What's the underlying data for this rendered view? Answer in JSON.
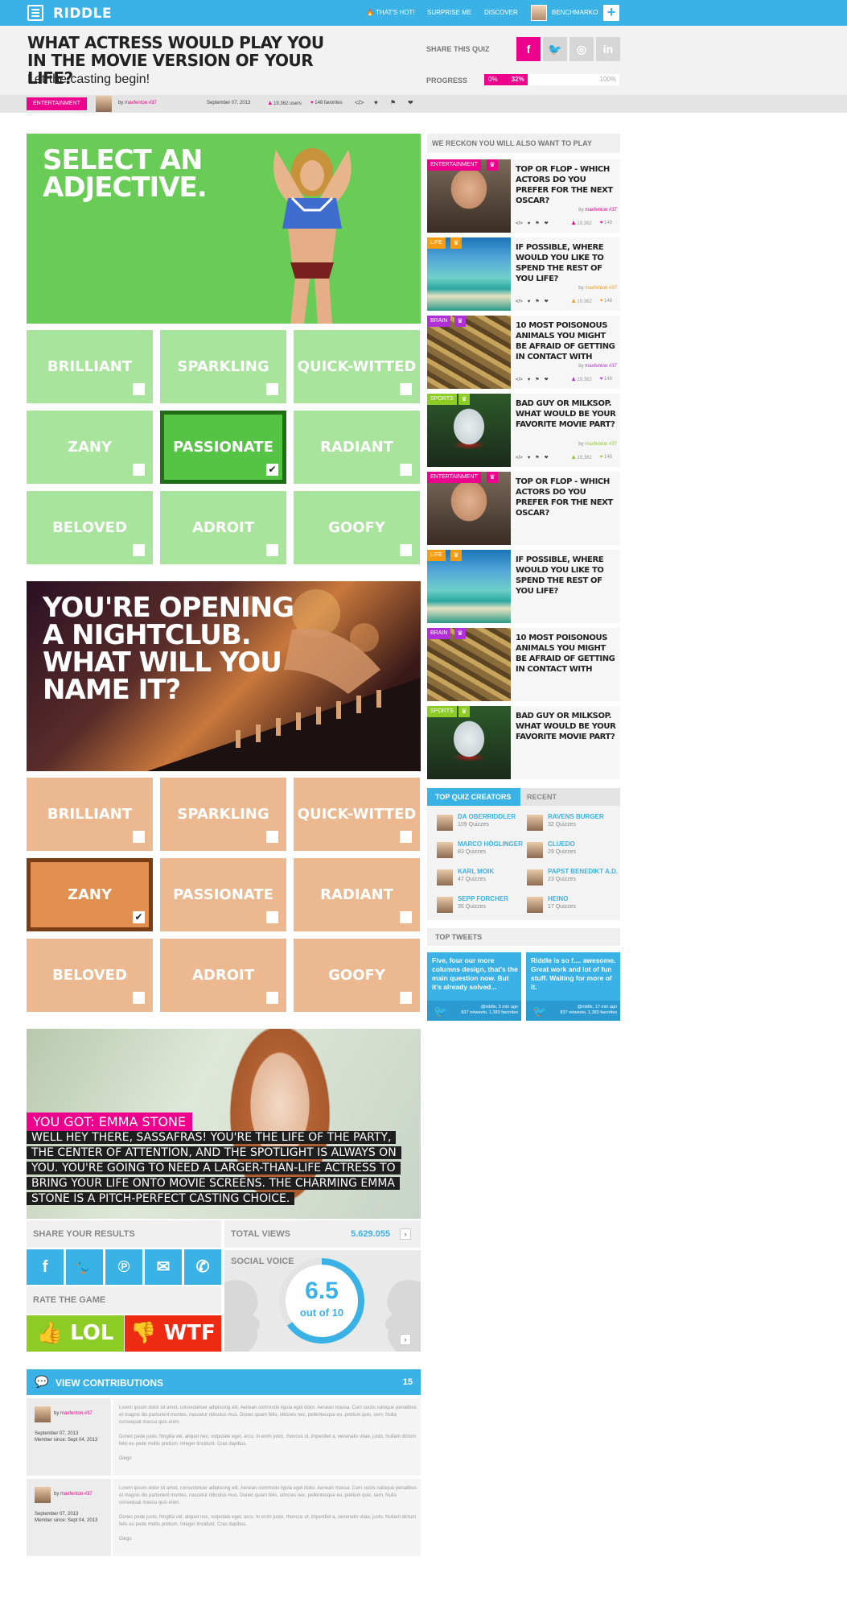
{
  "brand": {
    "logo": "RIDDLE",
    "accent": "#3bb2e5",
    "pink": "#ec008c"
  },
  "nav": {
    "items": [
      "THAT'S HOT!",
      "SURPRISE ME",
      "DISCOVER"
    ],
    "user": "BENCHMARKO",
    "plus": "+"
  },
  "quiz": {
    "title": "WHAT ACTRESS WOULD PLAY YOU IN THE MOVIE VERSION OF YOUR LIFE?",
    "subtitle": "Let the casting begin!",
    "share_label": "SHARE THIS QUIZ",
    "progress_label": "PROGRESS",
    "progress_min": "0%",
    "progress_value": "32%",
    "progress_fraction": 0.32,
    "progress_max": "100%",
    "category": "ENTERTAINMENT",
    "by": "by",
    "author": "maxfenton #37",
    "date": "September 07, 2013",
    "users": "19,362 users",
    "favorites": "148 favorites",
    "embed": "</>"
  },
  "q1": {
    "title": "SELECT AN ADJECTIVE.",
    "options": [
      "BRILLIANT",
      "SPARKLING",
      "QUICK-WITTED",
      "ZANY",
      "PASSIONATE",
      "RADIANT",
      "BELOVED",
      "ADROIT",
      "GOOFY"
    ],
    "selected": "PASSIONATE"
  },
  "q2": {
    "title": "YOU'RE OPENING A NIGHTCLUB. WHAT WILL YOU NAME IT?",
    "options": [
      "BRILLIANT",
      "SPARKLING",
      "QUICK-WITTED",
      "ZANY",
      "PASSIONATE",
      "RADIANT",
      "BELOVED",
      "ADROIT",
      "GOOFY"
    ],
    "selected": "ZANY"
  },
  "result": {
    "heading": "YOU GOT: EMMA STONE",
    "text": "WELL HEY THERE, SASSAFRAS! YOU'RE THE LIFE OF THE PARTY, THE CENTER OF ATTENTION, AND THE SPOTLIGHT IS ALWAYS ON YOU. YOU'RE GOING TO NEED A LARGER-THAN-LIFE ACTRESS TO BRING YOUR LIFE ONTO MOVIE SCREENS. THE CHARMING EMMA STONE IS A PITCH-PERFECT CASTING CHOICE."
  },
  "share_results": {
    "label": "SHARE YOUR RESULTS"
  },
  "views": {
    "label": "TOTAL VIEWS",
    "value": "5.629.055"
  },
  "rate": {
    "label": "RATE THE GAME",
    "lol": "LOL",
    "wtf": "WTF"
  },
  "social": {
    "label": "SOCIAL VOICE",
    "score": "6.5",
    "sub": "out of 10",
    "fraction": 0.65
  },
  "contributions": {
    "label": "VIEW CONTRIBUTIONS",
    "count": "15",
    "items": [
      {
        "by": "by",
        "author": "maxfenton #37",
        "date": "September 07, 2013",
        "member": "Member since: Sept 04, 2013",
        "p1": "Lorem ipsum dolor sit amet, consectetuer adipiscing elit. Aenean commodo ligula eget dolor. Aenean massa. Cum sociis natoque penatibus et magnis dis parturient montes, nascetur ridiculus mus. Donec quam felis, ultricies nec, pellentesque eu, pretium quis, sem. Nulla consequat massa quis enim.",
        "p2": "Donec pede justo, fringilla vel, aliquet nec, vulputate eget, arcu. In enim justo, rhoncus ut, imperdiet a, venenatis vitae, justo. Nullam dictum felis eu pede mollis pretium. Integer tincidunt. Cras dapibus.",
        "sign": "Diego"
      },
      {
        "by": "by",
        "author": "maxfenton #37",
        "date": "September 07, 2013",
        "member": "Member since: Sept 04, 2013",
        "p1": "Lorem ipsum dolor sit amet, consectetuer adipiscing elit. Aenean commodo ligula eget dolor. Aenean massa. Cum sociis natoque penatibus et magnis dis parturient montes, nascetur ridiculus mus. Donec quam felis, ultricies nec, pellentesque eu, pretium quis, sem. Nulla consequat massa quis enim.",
        "p2": "Donec pede justo, fringilla vel, aliquet nec, vulputate eget, arcu. In enim justo, rhoncus ut, imperdiet a, venenatis vitae, justo. Nullam dictum felis eu pede mollis pretium. Integer tincidunt. Cras dapibus.",
        "sign": "Diego"
      }
    ]
  },
  "sidebar": {
    "heading": "WE RECKON YOU WILL ALSO WANT TO PLAY",
    "cards": [
      {
        "badge": "ENTERTAINMENT",
        "color": "#ec008c",
        "title": "TOP OR FLOP - WHICH ACTORS DO YOU PREFER FOR THE NEXT OSCAR?",
        "by": "by",
        "author": "maxfenton #37",
        "users": "19,362",
        "favs": "148"
      },
      {
        "badge": "LIFE",
        "color": "#f39c12",
        "title": "IF POSSIBLE, WHERE WOULD YOU LIKE TO SPEND THE REST OF YOU LIFE?",
        "by": "by",
        "author": "maxfenton #37",
        "users": "19,362",
        "favs": "148"
      },
      {
        "badge": "BRAIN",
        "color": "#b12fd6",
        "title": "10 MOST POISONOUS ANIMALS YOU MIGHT BE AFRAID OF GETTING IN CONTACT WITH",
        "by": "by",
        "author": "maxfenton #37",
        "users": "19,362",
        "favs": "148"
      },
      {
        "badge": "SPORTS",
        "color": "#8ccc24",
        "title": "BAD GUY OR MILKSOP. WHAT WOULD BE YOUR FAVORITE MOVIE PART?",
        "by": "by",
        "author": "maxfenton #37",
        "users": "19,362",
        "favs": "148"
      },
      {
        "badge": "ENTERTAINMENT",
        "color": "#ec008c",
        "title": "TOP OR FLOP - WHICH ACTORS DO YOU PREFER FOR THE NEXT OSCAR?"
      },
      {
        "badge": "LIFE",
        "color": "#f39c12",
        "title": "IF POSSIBLE, WHERE WOULD YOU LIKE TO SPEND THE REST OF YOU LIFE?"
      },
      {
        "badge": "BRAIN",
        "color": "#b12fd6",
        "title": "10 MOST POISONOUS ANIMALS YOU MIGHT BE AFRAID OF GETTING IN CONTACT WITH"
      },
      {
        "badge": "SPORTS",
        "color": "#8ccc24",
        "title": "BAD GUY OR MILKSOP. WHAT WOULD BE YOUR FAVORITE MOVIE PART?"
      }
    ]
  },
  "creators": {
    "tab_top": "TOP QUIZ CREATORS",
    "tab_recent": "RECENT",
    "list": [
      {
        "name": "DA OBERRIDDLER",
        "quizzes": "109 Quizzes"
      },
      {
        "name": "RAVENS BURGER",
        "quizzes": "32 Quizzes"
      },
      {
        "name": "MARCO HÖGLINGER",
        "quizzes": "83 Quizzes"
      },
      {
        "name": "CLUEDO",
        "quizzes": "29 Quizzes"
      },
      {
        "name": "KARL MOIK",
        "quizzes": "47 Quizzes"
      },
      {
        "name": "PAPST BENEDIKT A.D.",
        "quizzes": "23 Quizzes"
      },
      {
        "name": "SEPP FORCHER",
        "quizzes": "35 Quizzes"
      },
      {
        "name": "HEINO",
        "quizzes": "17 Quizzes"
      }
    ]
  },
  "tweets": {
    "heading": "TOP TWEETS",
    "items": [
      {
        "text": "Five, four our more columns design, that's the main question now. But it's already solved...",
        "meta1": "@riddle, 5 min ago",
        "meta2": "837 retweets, 1,383 favorites"
      },
      {
        "text": "Riddle is so f.... awesome. Great work and lot of fun stuff. Waiting for more of it.",
        "meta1": "@riddle, 17 min ago",
        "meta2": "837 retweets, 1,383 favorites"
      }
    ]
  }
}
